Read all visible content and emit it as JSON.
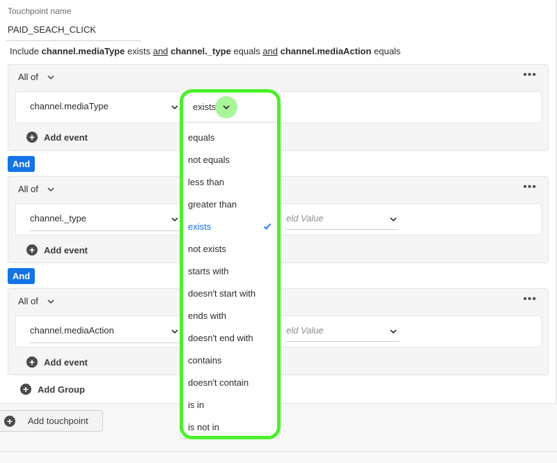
{
  "touchpoint": {
    "name_label": "Touchpoint name",
    "name_value": "PAID_SEACH_CLICK"
  },
  "summary": {
    "include": "Include",
    "attr1": "channel.mediaType",
    "op1": "exists",
    "and1": "and",
    "attr2": "channel._type",
    "op2": "equals",
    "and2": "and",
    "attr3": "channel.mediaAction",
    "op3": "equals"
  },
  "groups": [
    {
      "header": "All of",
      "attribute": "channel.mediaType",
      "value_placeholder": "",
      "add_event": "Add event"
    },
    {
      "header": "All of",
      "attribute": "channel._type",
      "value_placeholder": "eld Value",
      "add_event": "Add event"
    },
    {
      "header": "All of",
      "attribute": "channel.mediaAction",
      "value_placeholder": "eld Value",
      "add_event": "Add event"
    }
  ],
  "and_labels": [
    "And",
    "And"
  ],
  "add_group": "Add Group",
  "add_touchpoint": "Add touchpoint",
  "more_icon": "•••",
  "operator_dropdown": {
    "selected": "exists",
    "options": [
      "equals",
      "not equals",
      "less than",
      "greater than",
      "exists",
      "not exists",
      "starts with",
      "doesn't start with",
      "ends with",
      "doesn't end with",
      "contains",
      "doesn't contain",
      "is in",
      "is not in"
    ]
  },
  "colors": {
    "accent": "#1473e6",
    "highlight": "#4bf02a",
    "chevron_highlight": "#a8f59a"
  }
}
